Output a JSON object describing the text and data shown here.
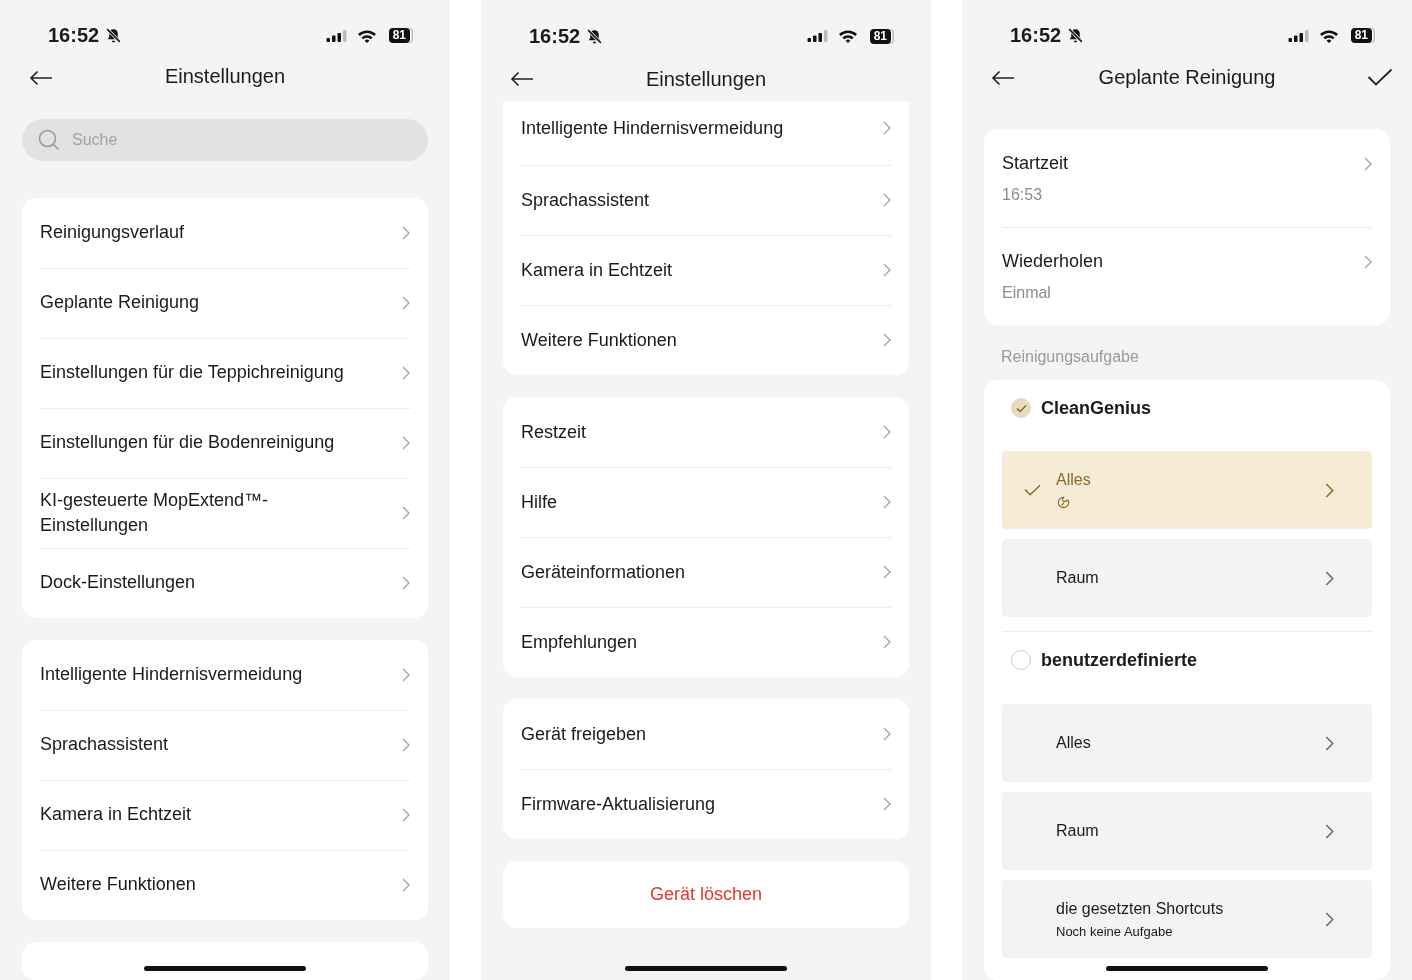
{
  "screens": [
    {
      "status_bar": {
        "time": "16:52",
        "battery": "81"
      },
      "header": {
        "title": "Einstellungen"
      },
      "search": {
        "placeholder": "Suche"
      },
      "groups": [
        {
          "kind": "list",
          "items": [
            {
              "label": "Reinigungsverlauf"
            },
            {
              "label": "Geplante Reinigung"
            },
            {
              "label": "Einstellungen für die Teppichreinigung"
            },
            {
              "label": "Einstellungen für die Bodenreinigung"
            },
            {
              "label": "KI-gesteuerte MopExtend™-Einstellungen"
            },
            {
              "label": "Dock-Einstellungen"
            }
          ]
        },
        {
          "kind": "list",
          "items": [
            {
              "label": "Intelligente Hindernisvermeidung"
            },
            {
              "label": "Sprachassistent"
            },
            {
              "label": "Kamera in Echtzeit"
            },
            {
              "label": "Weitere Funktionen"
            }
          ]
        },
        {
          "kind": "peek"
        }
      ]
    },
    {
      "status_bar": {
        "time": "16:52",
        "battery": "81"
      },
      "header": {
        "title": "Einstellungen"
      },
      "groups": [
        {
          "kind": "continued",
          "items": [
            {
              "label": "Intelligente Hindernisvermeidung"
            },
            {
              "label": "Sprachassistent"
            },
            {
              "label": "Kamera in Echtzeit"
            },
            {
              "label": "Weitere Funktionen"
            }
          ]
        },
        {
          "kind": "list",
          "items": [
            {
              "label": "Restzeit"
            },
            {
              "label": "Hilfe"
            },
            {
              "label": "Geräteinformationen"
            },
            {
              "label": "Empfehlungen"
            }
          ]
        },
        {
          "kind": "list",
          "items": [
            {
              "label": "Gerät freigeben"
            },
            {
              "label": "Firmware-Aktualisierung"
            }
          ]
        },
        {
          "kind": "action",
          "items": [
            {
              "label": "Gerät löschen"
            }
          ]
        }
      ]
    },
    {
      "status_bar": {
        "time": "16:52",
        "battery": "81"
      },
      "header": {
        "title": "Geplante Reinigung",
        "confirm": true
      },
      "schedule": [
        {
          "label": "Startzeit",
          "value": "16:53"
        },
        {
          "label": "Wiederholen",
          "value": "Einmal"
        }
      ],
      "task": {
        "heading": "Reinigungsaufgabe",
        "modes": [
          {
            "label": "CleanGenius",
            "selected": true,
            "options": [
              {
                "label": "Alles",
                "selected": true,
                "smart_icon": true
              },
              {
                "label": "Raum",
                "selected": false
              }
            ]
          },
          {
            "label": "benutzerdefinierte",
            "selected": false,
            "options": [
              {
                "label": "Alles",
                "selected": false
              },
              {
                "label": "Raum",
                "selected": false
              },
              {
                "label": "die gesetzten Shortcuts",
                "note": "Noch keine Aufgabe",
                "selected": false
              }
            ]
          }
        ]
      }
    }
  ]
}
